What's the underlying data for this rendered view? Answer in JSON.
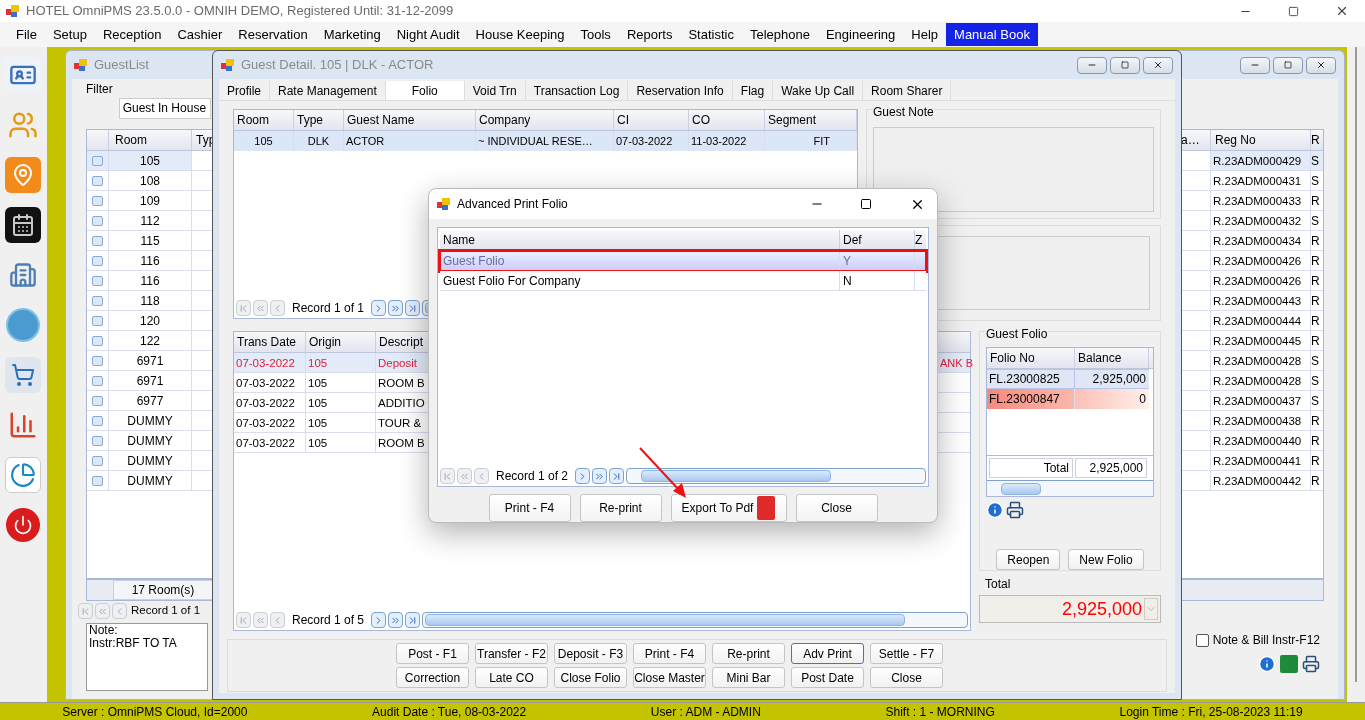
{
  "app": {
    "title": "HOTEL OmniPMS 23.5.0.0 - OMNIH DEMO, Registered Until: 31-12-2099"
  },
  "menu": [
    {
      "label": "File",
      "highlighted": false
    },
    {
      "label": "Setup",
      "highlighted": false
    },
    {
      "label": "Reception",
      "highlighted": false
    },
    {
      "label": "Cashier",
      "highlighted": false
    },
    {
      "label": "Reservation",
      "highlighted": false
    },
    {
      "label": "Marketing",
      "highlighted": false
    },
    {
      "label": "Night Audit",
      "highlighted": false
    },
    {
      "label": "House Keeping",
      "highlighted": false
    },
    {
      "label": "Tools",
      "highlighted": false
    },
    {
      "label": "Reports",
      "highlighted": false
    },
    {
      "label": "Statistic",
      "highlighted": false
    },
    {
      "label": "Telephone",
      "highlighted": false
    },
    {
      "label": "Engineering",
      "highlighted": false
    },
    {
      "label": "Help",
      "highlighted": false
    },
    {
      "label": "Manual Book",
      "highlighted": true
    }
  ],
  "guest_list": {
    "title": "GuestList",
    "filter_label": "Filter",
    "filter_value": "Guest In House",
    "columns": [
      "Room",
      "Typ",
      "a…",
      "Reg No",
      "R"
    ],
    "rows": [
      {
        "room": "105",
        "reg_no": "R.23ADM000429",
        "column_5": "S",
        "selected": true
      },
      {
        "room": "108",
        "reg_no": "R.23ADM000431",
        "column_5": "S",
        "selected": false
      },
      {
        "room": "109",
        "reg_no": "R.23ADM000433",
        "column_5": "R",
        "selected": false
      },
      {
        "room": "112",
        "reg_no": "R.23ADM000432",
        "column_5": "S",
        "selected": false
      },
      {
        "room": "115",
        "reg_no": "R.23ADM000434",
        "column_5": "R",
        "selected": false
      },
      {
        "room": "116",
        "reg_no": "R.23ADM000426",
        "column_5": "R",
        "selected": false
      },
      {
        "room": "116",
        "reg_no": "R.23ADM000426",
        "column_5": "R",
        "selected": false
      },
      {
        "room": "118",
        "reg_no": "R.23ADM000443",
        "column_5": "R",
        "selected": false
      },
      {
        "room": "120",
        "reg_no": "R.23ADM000444",
        "column_5": "R",
        "selected": false
      },
      {
        "room": "122",
        "reg_no": "R.23ADM000445",
        "column_5": "R",
        "selected": false
      },
      {
        "room": "6971",
        "reg_no": "R.23ADM000428",
        "column_5": "S",
        "selected": false
      },
      {
        "room": "6971",
        "reg_no": "R.23ADM000428",
        "column_5": "S",
        "selected": false
      },
      {
        "room": "6977",
        "reg_no": "R.23ADM000437",
        "column_5": "S",
        "selected": false
      },
      {
        "room": "DUMMY",
        "reg_no": "R.23ADM000438",
        "column_5": "R",
        "selected": false
      },
      {
        "room": "DUMMY",
        "reg_no": "R.23ADM000440",
        "column_5": "R",
        "selected": false
      },
      {
        "room": "DUMMY",
        "reg_no": "R.23ADM000441",
        "column_5": "R",
        "selected": false
      },
      {
        "room": "DUMMY",
        "reg_no": "R.23ADM000442",
        "column_5": "R",
        "selected": false
      }
    ],
    "room_count": "17 Room(s)",
    "record": "Record 1 of 1",
    "note": [
      "Note:",
      "Instr:RBF TO TA"
    ],
    "note_checkbox": {
      "label": "Note & Bill Instr-F12",
      "checked": false
    }
  },
  "guest_detail": {
    "title": "Guest Detail. 105 | DLK - ACTOR",
    "tabs": [
      {
        "label": "Profile",
        "selected": false
      },
      {
        "label": "Rate Management",
        "selected": false
      },
      {
        "label": "Folio",
        "selected": true
      },
      {
        "label": "Void Trn",
        "selected": false
      },
      {
        "label": "Transaction Log",
        "selected": false
      },
      {
        "label": "Reservation Info",
        "selected": false
      },
      {
        "label": "Flag",
        "selected": false
      },
      {
        "label": "Wake Up Call",
        "selected": false
      },
      {
        "label": "Room Sharer",
        "selected": false
      }
    ],
    "stay": {
      "columns": [
        "Room",
        "Type",
        "Guest Name",
        "Company",
        "CI",
        "CO",
        "Segment"
      ],
      "rows": [
        {
          "cells": [
            "105",
            "DLK",
            "ACTOR",
            "~ INDIVIDUAL RESE…",
            "07-03-2022",
            "11-03-2022",
            "FIT"
          ],
          "selected": true
        }
      ],
      "record": "Record 1 of 1"
    },
    "guest_note_label": "Guest Note",
    "transactions": {
      "columns": [
        "Trans Date",
        "Origin",
        "Descript"
      ],
      "rows": [
        {
          "cells": [
            "07-03-2022",
            "105",
            "Deposit"
          ],
          "extra": "ANK B",
          "highlighted": true
        },
        {
          "cells": [
            "07-03-2022",
            "105",
            "ROOM B"
          ],
          "highlighted": false
        },
        {
          "cells": [
            "07-03-2022",
            "105",
            "ADDITIO"
          ],
          "highlighted": false
        },
        {
          "cells": [
            "07-03-2022",
            "105",
            "TOUR &"
          ],
          "highlighted": false
        },
        {
          "cells": [
            "07-03-2022",
            "105",
            "ROOM B"
          ],
          "highlighted": false
        }
      ],
      "record": "Record 1 of 5"
    },
    "guest_folio": {
      "label": "Guest Folio",
      "columns": [
        "Folio No",
        "Balance"
      ],
      "rows": [
        {
          "folio_no": "FL.23000825",
          "balance": "2,925,000",
          "selected": true,
          "alert": false
        },
        {
          "folio_no": "FL.23000847",
          "balance": "0",
          "selected": false,
          "alert": true
        }
      ],
      "total_label": "Total",
      "total_value": "2,925,000",
      "buttons": [
        "Reopen",
        "New Folio"
      ]
    },
    "total_label": "Total",
    "total_value": "2,925,000",
    "buttons": [
      [
        {
          "label": "Post - F1",
          "focused": false
        },
        {
          "label": "Transfer - F2",
          "focused": false
        },
        {
          "label": "Deposit - F3",
          "focused": false
        },
        {
          "label": "Print - F4",
          "focused": false
        },
        {
          "label": "Re-print",
          "focused": false
        },
        {
          "label": "Adv Print",
          "focused": true
        },
        {
          "label": "Settle - F7",
          "focused": false
        }
      ],
      [
        {
          "label": "Correction",
          "focused": false
        },
        {
          "label": "Late CO",
          "focused": false
        },
        {
          "label": "Close Folio",
          "focused": false
        },
        {
          "label": "Close Master",
          "focused": false
        },
        {
          "label": "Mini Bar",
          "focused": false
        },
        {
          "label": "Post Date",
          "focused": false
        },
        {
          "label": "Close",
          "focused": false
        }
      ]
    ]
  },
  "dialog": {
    "title": "Advanced Print Folio",
    "columns": [
      "Name",
      "Def",
      "Z"
    ],
    "rows": [
      {
        "name": "Guest Folio",
        "def": "Y",
        "selected": true
      },
      {
        "name": "Guest Folio For Company",
        "def": "N",
        "selected": false
      }
    ],
    "record": "Record 1 of 2",
    "buttons": [
      {
        "label": "Print - F4",
        "kind": "plain"
      },
      {
        "label": "Re-print",
        "kind": "plain"
      },
      {
        "label": "Export To Pdf",
        "kind": "pdf"
      },
      {
        "label": "Close",
        "kind": "plain"
      }
    ]
  },
  "status_bar": [
    "Server : OmniPMS Cloud, Id=2000",
    "Audit Date : Tue, 08-03-2022",
    "User : ADM - ADMIN",
    "Shift : 1 - MORNING",
    "Login Time : Fri, 25-08-2023 11:19"
  ]
}
